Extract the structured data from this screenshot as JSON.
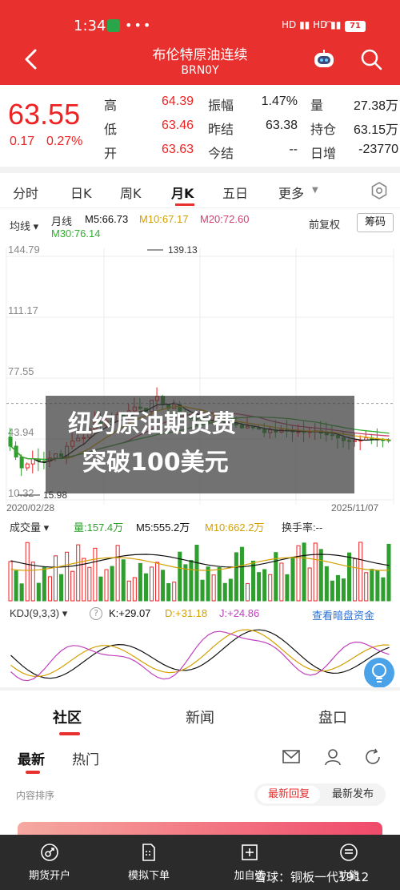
{
  "status_bar": {
    "time": "1:34",
    "dots": "•••",
    "signal": "HD ▮▮ HD ▮▮",
    "battery": "71"
  },
  "header": {
    "title": "布伦特原油连续",
    "subtitle": "BRN0Y"
  },
  "quote": {
    "price": "63.55",
    "change": "0.17",
    "change_pct": "0.27%",
    "rows": [
      {
        "l1": "高",
        "v1": "64.39",
        "l2": "振幅",
        "v2": "1.47%",
        "l3": "量",
        "v3": "27.38万"
      },
      {
        "l1": "低",
        "v1": "63.46",
        "l2": "昨结",
        "v2": "63.38",
        "l3": "持仓",
        "v3": "63.15万"
      },
      {
        "l1": "开",
        "v1": "63.63",
        "l2": "今结",
        "v2": "--",
        "l3": "日增",
        "v3": "-23770"
      }
    ]
  },
  "tabs": {
    "items": [
      "分时",
      "日K",
      "周K",
      "月K",
      "五日",
      "更多"
    ],
    "active": "月K"
  },
  "kline": {
    "ma_select": "均线",
    "period": "月线",
    "ma5": "M5:66.73",
    "ma10": "M10:67.17",
    "ma20": "M20:72.60",
    "ma30": "M30:76.14",
    "adjust": "前复权",
    "chips": "筹码",
    "price_axis": [
      "144.79",
      "111.17",
      "77.55",
      "43.94",
      "10.32"
    ],
    "max_label": "139.13",
    "min_label": "15.98",
    "date_start": "2020/02/28",
    "date_end": "2025/11/07"
  },
  "volume": {
    "select": "成交量",
    "vol": "量:157.4万",
    "m5": "M5:555.2万",
    "m10": "M10:662.2万",
    "turnover": "换手率:--"
  },
  "kdj": {
    "select": "KDJ(9,3,3)",
    "k": "K:+29.07",
    "d": "D:+31.18",
    "j": "J:+24.86",
    "link": "查看暗盘资金"
  },
  "overlay": {
    "line1": "纽约原油期货费",
    "line2": "突破100美元"
  },
  "community": {
    "tabs": [
      "社区",
      "新闻",
      "盘口"
    ]
  },
  "subtabs": {
    "items": [
      "最新",
      "热门"
    ]
  },
  "sort": {
    "label": "内容排序",
    "opt1": "最新回复",
    "opt2": "最新发布"
  },
  "bottom_nav": {
    "items": [
      "期货开户",
      "模拟下单",
      "加自选",
      "功能"
    ]
  },
  "watermark": "雪球：铜板一代1912",
  "colors": {
    "red": "#e8302f",
    "up": "#e22",
    "down": "#2f9e2f",
    "ma5": "#111",
    "ma10": "#e0a800",
    "ma20": "#d04070",
    "ma30": "#2fae2f"
  }
}
